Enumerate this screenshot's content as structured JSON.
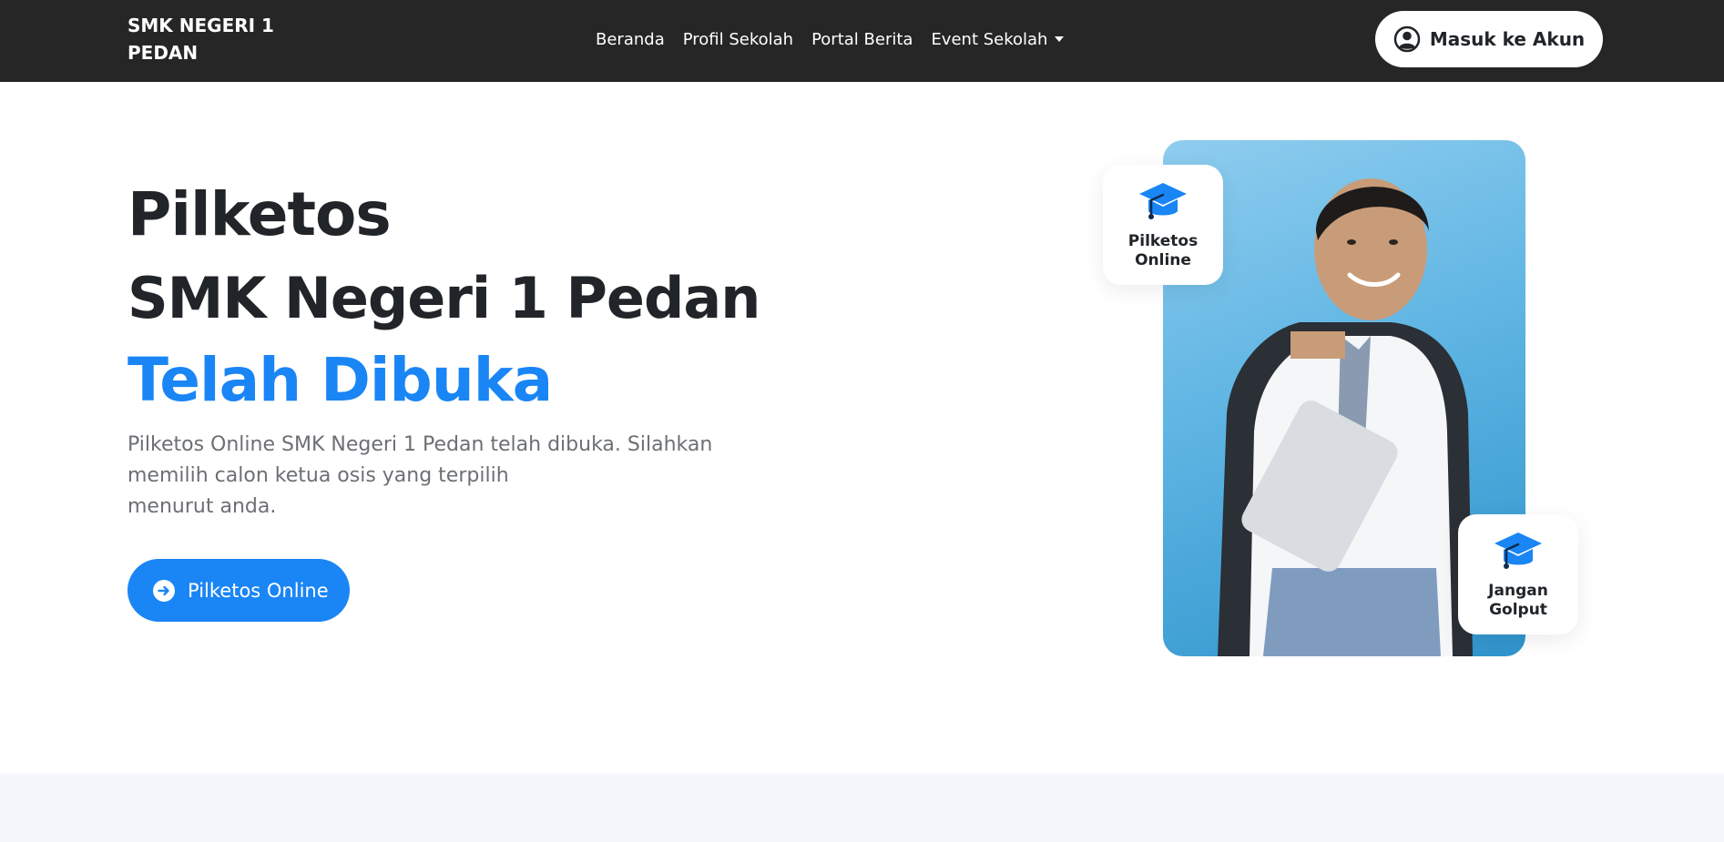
{
  "navbar": {
    "brand_line1": "SMK NEGERI 1",
    "brand_line2": "PEDAN",
    "links": [
      {
        "label": "Beranda"
      },
      {
        "label": "Profil Sekolah"
      },
      {
        "label": "Portal Berita"
      },
      {
        "label": "Event Sekolah"
      }
    ],
    "login_label": "Masuk ke Akun",
    "login_icon": "user-circle-icon"
  },
  "hero": {
    "title_line1": "Pilketos",
    "title_line2": "SMK Negeri 1 Pedan",
    "title_line3": "Telah Dibuka",
    "desc_line1": "Pilketos Online SMK Negeri 1 Pedan telah dibuka. Silahkan",
    "desc_line2": "memilih calon ketua osis yang terpilih",
    "desc_line3": "menurut anda.",
    "cta_label": "Pilketos Online",
    "cta_icon": "arrow-right-circle-icon"
  },
  "badges": [
    {
      "line1": "Pilketos",
      "line2": "Online",
      "icon": "graduation-cap-icon"
    },
    {
      "line1": "Jangan",
      "line2": "Golput",
      "icon": "graduation-cap-icon"
    }
  ],
  "colors": {
    "navbar_bg": "#262626",
    "accent": "#1a85f5",
    "title_dark": "#212529",
    "desc_gray": "#6c6f74",
    "footer_strip": "#f5f7fd"
  }
}
